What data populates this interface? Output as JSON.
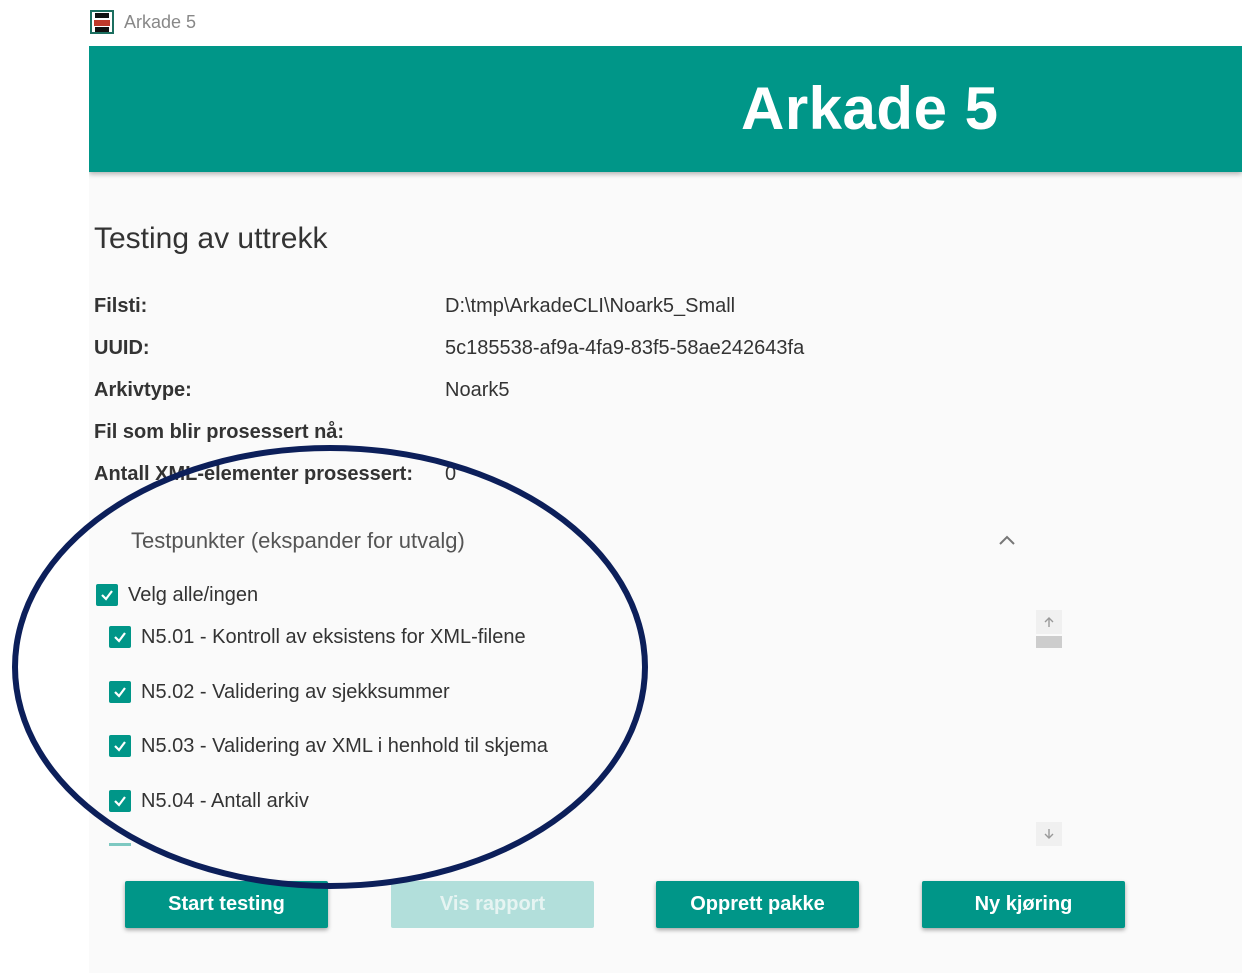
{
  "window": {
    "title": "Arkade 5"
  },
  "header": {
    "title": "Arkade 5"
  },
  "page": {
    "title": "Testing av uttrekk"
  },
  "info": [
    {
      "label": "Filsti:",
      "value": "D:\\tmp\\ArkadeCLI\\Noark5_Small"
    },
    {
      "label": "UUID:",
      "value": "5c185538-af9a-4fa9-83f5-58ae242643fa"
    },
    {
      "label": "Arkivtype:",
      "value": "Noark5"
    },
    {
      "label": "Fil som blir prosessert nå:",
      "value": ""
    },
    {
      "label": "Antall XML-elementer prosessert:",
      "value": "0"
    }
  ],
  "testpoints": {
    "header": "Testpunkter (ekspander for utvalg)",
    "expanded": true,
    "select_all": {
      "label": "Velg alle/ingen",
      "checked": true
    },
    "items": [
      {
        "label": "N5.01 - Kontroll av eksistens for XML-filene",
        "checked": true
      },
      {
        "label": "N5.02 - Validering av sjekksummer",
        "checked": true
      },
      {
        "label": "N5.03 - Validering av XML i henhold til skjema",
        "checked": true
      },
      {
        "label": "N5.04 - Antall arkiv",
        "checked": true
      }
    ]
  },
  "buttons": {
    "start_testing": {
      "label": "Start testing",
      "enabled": true
    },
    "vis_rapport": {
      "label": "Vis rapport",
      "enabled": false
    },
    "opprett_pakke": {
      "label": "Opprett pakke",
      "enabled": true
    },
    "ny_kjoring": {
      "label": "Ny kjøring",
      "enabled": true
    }
  },
  "colors": {
    "accent": "#009688",
    "accent_disabled": "#b2dfdb",
    "annotation": "#0c1f5a"
  },
  "icons": {
    "app": "arkade-app-icon",
    "expander": "chevron-up-icon",
    "checkbox": "checkmark-icon",
    "scroll_up": "arrow-up-icon",
    "scroll_down": "arrow-down-icon"
  }
}
